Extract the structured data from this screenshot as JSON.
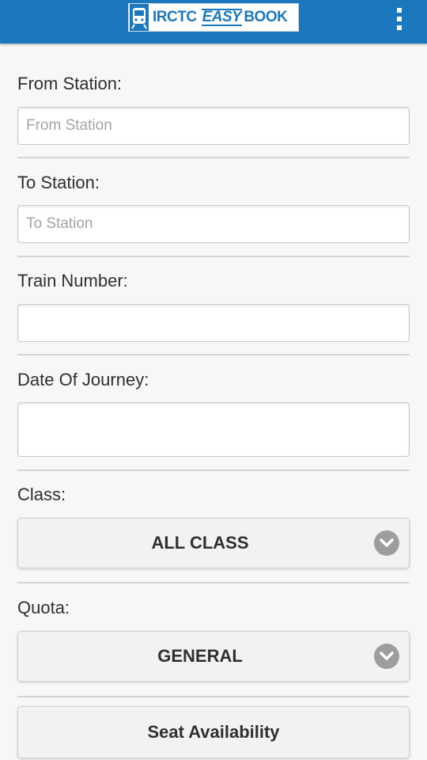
{
  "header": {
    "logo": {
      "part1": "IRCTC",
      "part2": "EASY",
      "part3": "BOOK",
      "icon": "train-icon"
    },
    "menu_icon": "overflow-menu-icon"
  },
  "form": {
    "from_station": {
      "label": "From Station:",
      "placeholder": "From Station",
      "value": ""
    },
    "to_station": {
      "label": "To Station:",
      "placeholder": "To Station",
      "value": ""
    },
    "train_number": {
      "label": "Train Number:",
      "placeholder": "",
      "value": ""
    },
    "date_of_journey": {
      "label": "Date Of Journey:",
      "placeholder": "",
      "value": ""
    },
    "class": {
      "label": "Class:",
      "selected": "ALL CLASS",
      "icon": "chevron-down-icon"
    },
    "quota": {
      "label": "Quota:",
      "selected": "GENERAL",
      "icon": "chevron-down-icon"
    },
    "seat_availability_label": "Seat Availability"
  },
  "colors": {
    "header_bg": "#1b78bd",
    "page_bg": "#f7f7f7",
    "chevron_bg": "#9d9d9d"
  }
}
